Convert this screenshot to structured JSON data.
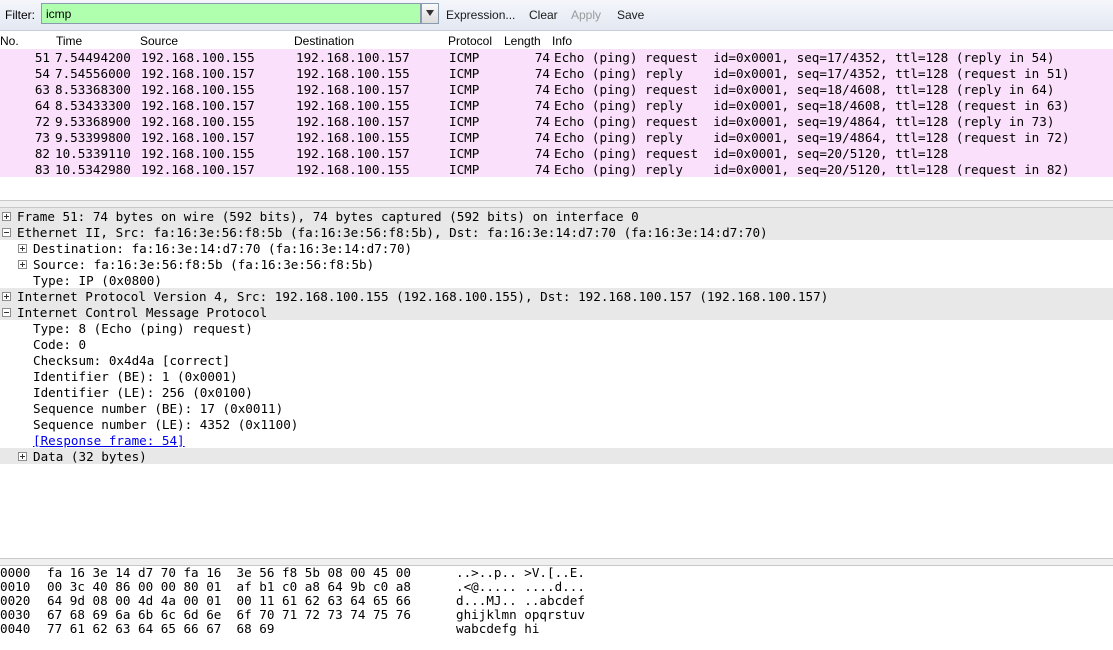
{
  "filter": {
    "label": "Filter:",
    "value": "icmp",
    "expression_label": "Expression...",
    "clear_label": "Clear",
    "apply_label": "Apply",
    "save_label": "Save",
    "valid_color": "#afffaf"
  },
  "packet_list": {
    "columns": [
      "No.",
      "Time",
      "Source",
      "Destination",
      "Protocol",
      "Length",
      "Info"
    ],
    "row_color": "#fbe0fb",
    "rows": [
      {
        "no": "51",
        "time": "7.54494200",
        "src": "192.168.100.155",
        "dst": "192.168.100.157",
        "proto": "ICMP",
        "len": "74",
        "info": "Echo (ping) request  id=0x0001, seq=17/4352, ttl=128 (reply in 54)"
      },
      {
        "no": "54",
        "time": "7.54556000",
        "src": "192.168.100.157",
        "dst": "192.168.100.155",
        "proto": "ICMP",
        "len": "74",
        "info": "Echo (ping) reply    id=0x0001, seq=17/4352, ttl=128 (request in 51)"
      },
      {
        "no": "63",
        "time": "8.53368300",
        "src": "192.168.100.155",
        "dst": "192.168.100.157",
        "proto": "ICMP",
        "len": "74",
        "info": "Echo (ping) request  id=0x0001, seq=18/4608, ttl=128 (reply in 64)"
      },
      {
        "no": "64",
        "time": "8.53433300",
        "src": "192.168.100.157",
        "dst": "192.168.100.155",
        "proto": "ICMP",
        "len": "74",
        "info": "Echo (ping) reply    id=0x0001, seq=18/4608, ttl=128 (request in 63)"
      },
      {
        "no": "72",
        "time": "9.53368900",
        "src": "192.168.100.155",
        "dst": "192.168.100.157",
        "proto": "ICMP",
        "len": "74",
        "info": "Echo (ping) request  id=0x0001, seq=19/4864, ttl=128 (reply in 73)"
      },
      {
        "no": "73",
        "time": "9.53399800",
        "src": "192.168.100.157",
        "dst": "192.168.100.155",
        "proto": "ICMP",
        "len": "74",
        "info": "Echo (ping) reply    id=0x0001, seq=19/4864, ttl=128 (request in 72)"
      },
      {
        "no": "82",
        "time": "10.5339110",
        "src": "192.168.100.155",
        "dst": "192.168.100.157",
        "proto": "ICMP",
        "len": "74",
        "info": "Echo (ping) request  id=0x0001, seq=20/5120, ttl=128"
      },
      {
        "no": "83",
        "time": "10.5342980",
        "src": "192.168.100.157",
        "dst": "192.168.100.155",
        "proto": "ICMP",
        "len": "74",
        "info": "Echo (ping) reply    id=0x0001, seq=20/5120, ttl=128 (request in 82)"
      }
    ]
  },
  "details": {
    "highlight_color": "#e8e8e8",
    "items": [
      {
        "text": "Frame 51: 74 bytes on wire (592 bits), 74 bytes captured (592 bits) on interface 0",
        "indent": 0,
        "expander": "plus",
        "highlight": true
      },
      {
        "text": "Ethernet II, Src: fa:16:3e:56:f8:5b (fa:16:3e:56:f8:5b), Dst: fa:16:3e:14:d7:70 (fa:16:3e:14:d7:70)",
        "indent": 0,
        "expander": "minus",
        "highlight": true
      },
      {
        "text": "Destination: fa:16:3e:14:d7:70 (fa:16:3e:14:d7:70)",
        "indent": 1,
        "expander": "plus",
        "highlight": false
      },
      {
        "text": "Source: fa:16:3e:56:f8:5b (fa:16:3e:56:f8:5b)",
        "indent": 1,
        "expander": "plus",
        "highlight": false
      },
      {
        "text": "Type: IP (0x0800)",
        "indent": 1,
        "expander": "none",
        "highlight": false
      },
      {
        "text": "Internet Protocol Version 4, Src: 192.168.100.155 (192.168.100.155), Dst: 192.168.100.157 (192.168.100.157)",
        "indent": 0,
        "expander": "plus",
        "highlight": true
      },
      {
        "text": "Internet Control Message Protocol",
        "indent": 0,
        "expander": "minus",
        "highlight": true
      },
      {
        "text": "Type: 8 (Echo (ping) request)",
        "indent": 1,
        "expander": "none",
        "highlight": false
      },
      {
        "text": "Code: 0",
        "indent": 1,
        "expander": "none",
        "highlight": false
      },
      {
        "text": "Checksum: 0x4d4a [correct]",
        "indent": 1,
        "expander": "none",
        "highlight": false
      },
      {
        "text": "Identifier (BE): 1 (0x0001)",
        "indent": 1,
        "expander": "none",
        "highlight": false
      },
      {
        "text": "Identifier (LE): 256 (0x0100)",
        "indent": 1,
        "expander": "none",
        "highlight": false
      },
      {
        "text": "Sequence number (BE): 17 (0x0011)",
        "indent": 1,
        "expander": "none",
        "highlight": false
      },
      {
        "text": "Sequence number (LE): 4352 (0x1100)",
        "indent": 1,
        "expander": "none",
        "highlight": false
      },
      {
        "text": "[Response frame: 54]",
        "indent": 1,
        "expander": "none",
        "highlight": false,
        "link": true
      },
      {
        "text": "Data (32 bytes)",
        "indent": 1,
        "expander": "plus",
        "highlight": true
      }
    ]
  },
  "hex_dump": [
    {
      "offset": "0000",
      "hex": "fa 16 3e 14 d7 70 fa 16  3e 56 f8 5b 08 00 45 00",
      "ascii": "..>..p.. >V.[..E."
    },
    {
      "offset": "0010",
      "hex": "00 3c 40 86 00 00 80 01  af b1 c0 a8 64 9b c0 a8",
      "ascii": ".<@..... ....d..."
    },
    {
      "offset": "0020",
      "hex": "64 9d 08 00 4d 4a 00 01  00 11 61 62 63 64 65 66",
      "ascii": "d...MJ.. ..abcdef"
    },
    {
      "offset": "0030",
      "hex": "67 68 69 6a 6b 6c 6d 6e  6f 70 71 72 73 74 75 76",
      "ascii": "ghijklmn opqrstuv"
    },
    {
      "offset": "0040",
      "hex": "77 61 62 63 64 65 66 67  68 69",
      "ascii": "wabcdefg hi"
    }
  ]
}
